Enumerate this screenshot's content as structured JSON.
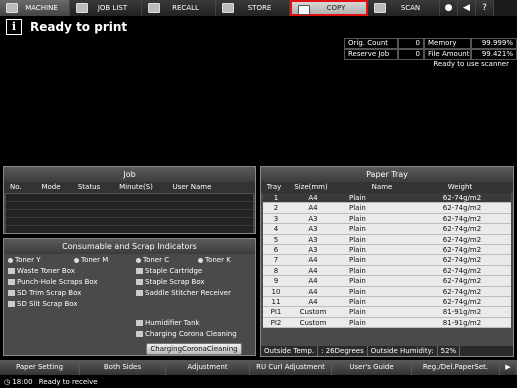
{
  "tabs": [
    {
      "label": "MACHINE",
      "active": true
    },
    {
      "label": "JOB LIST"
    },
    {
      "label": "RECALL"
    },
    {
      "label": "STORE"
    },
    {
      "label": "COPY",
      "highlighted": true
    },
    {
      "label": "SCAN"
    }
  ],
  "status": {
    "message": "Ready to print"
  },
  "counters": {
    "orig_count_label": "Orig. Count",
    "orig_count_value": "0",
    "memory_label": "Memory",
    "memory_value": "99.999%",
    "reserve_job_label": "Reserve Job",
    "reserve_job_value": "0",
    "file_amount_label": "File Amount",
    "file_amount_value": "99.421%",
    "scanner_msg": "Ready to use scanner"
  },
  "job": {
    "title": "Job",
    "headers": [
      "No.",
      "Mode",
      "Status",
      "Minute(S)",
      "User Name"
    ]
  },
  "consumables": {
    "title": "Consumable and Scrap Indicators",
    "toner_y": "Toner Y",
    "toner_m": "Toner M",
    "toner_c": "Toner C",
    "toner_k": "Toner K",
    "waste_toner": "Waste Toner Box",
    "punch_hole": "Punch-Hole Scraps Box",
    "sd_trim": "SD Trim Scrap Box",
    "sd_slit": "SD Slit Scrap Box",
    "staple_cartridge": "Staple Cartridge",
    "staple_scrap": "Staple Scrap Box",
    "saddle_stitcher": "Saddle Stitcher Receiver",
    "humidifier": "Humidifier Tank",
    "charging_corona": "Charging Corona Cleaning",
    "button": "ChargingCoronaCleaning"
  },
  "paper_tray": {
    "title": "Paper Tray",
    "headers": [
      "Tray",
      "Size(mm)",
      "Name",
      "Weight"
    ],
    "rows": [
      {
        "tray": "1",
        "size": "A4",
        "name": "Plain",
        "weight": "62-74g/m2"
      },
      {
        "tray": "2",
        "size": "A4",
        "name": "Plain",
        "weight": "62-74g/m2"
      },
      {
        "tray": "3",
        "size": "A3",
        "name": "Plain",
        "weight": "62-74g/m2"
      },
      {
        "tray": "4",
        "size": "A3",
        "name": "Plain",
        "weight": "62-74g/m2"
      },
      {
        "tray": "5",
        "size": "A3",
        "name": "Plain",
        "weight": "62-74g/m2"
      },
      {
        "tray": "6",
        "size": "A3",
        "name": "Plain",
        "weight": "62-74g/m2"
      },
      {
        "tray": "7",
        "size": "A4",
        "name": "Plain",
        "weight": "62-74g/m2"
      },
      {
        "tray": "8",
        "size": "A4",
        "name": "Plain",
        "weight": "62-74g/m2"
      },
      {
        "tray": "9",
        "size": "A4",
        "name": "Plain",
        "weight": "62-74g/m2"
      },
      {
        "tray": "10",
        "size": "A4",
        "name": "Plain",
        "weight": "62-74g/m2"
      },
      {
        "tray": "11",
        "size": "A4",
        "name": "Plain",
        "weight": "62-74g/m2"
      },
      {
        "tray": "PI1",
        "size": "Custom",
        "name": "Plain",
        "weight": "81-91g/m2"
      },
      {
        "tray": "PI2",
        "size": "Custom",
        "name": "Plain",
        "weight": "81-91g/m2"
      }
    ],
    "outside_temp_label": "Outside Temp.",
    "outside_temp_value": ": 26Degrees",
    "outside_humidity_label": "Outside Humidity:",
    "outside_humidity_value": "52%"
  },
  "bottom_buttons": [
    "Paper Setting",
    "Both Sides",
    "Adjustment",
    "RU Curl Adjustment",
    "User's Guide",
    "Reg./Del.PaperSet."
  ],
  "footer": {
    "time": "18:00",
    "message": "Ready to receive"
  }
}
